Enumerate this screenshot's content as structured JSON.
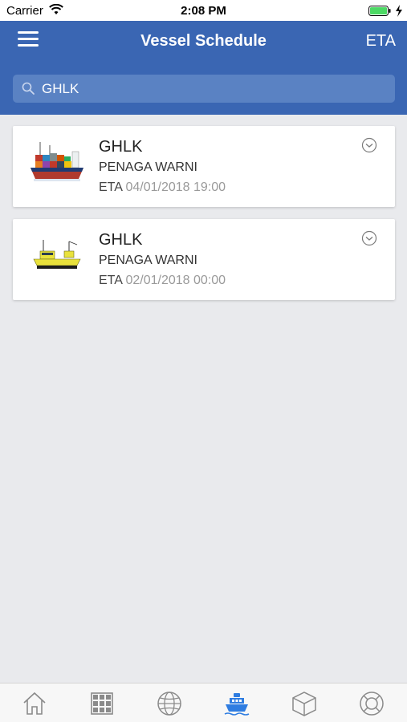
{
  "status_bar": {
    "carrier": "Carrier",
    "time": "2:08 PM"
  },
  "header": {
    "title": "Vessel Schedule",
    "right_action": "ETA"
  },
  "search": {
    "value": "GHLK",
    "placeholder": ""
  },
  "vessels": [
    {
      "code": "GHLK",
      "name": "PENAGA WARNI",
      "eta_label": "ETA",
      "eta_value": "04/01/2018 19:00",
      "image": "container-ship"
    },
    {
      "code": "GHLK",
      "name": "PENAGA WARNI",
      "eta_label": "ETA",
      "eta_value": "02/01/2018 00:00",
      "image": "yellow-supply-vessel"
    }
  ],
  "tabbar": {
    "items": [
      {
        "icon": "home-icon",
        "active": false
      },
      {
        "icon": "grid-icon",
        "active": false
      },
      {
        "icon": "globe-icon",
        "active": false
      },
      {
        "icon": "ship-icon",
        "active": true
      },
      {
        "icon": "box-icon",
        "active": false
      },
      {
        "icon": "lifebuoy-icon",
        "active": false
      }
    ]
  },
  "colors": {
    "header": "#3a66b3",
    "search_bg": "#5a82c3",
    "page_bg": "#e9eaed",
    "tab_active": "#2f7de1",
    "tab_inactive": "#8a8a8a"
  }
}
